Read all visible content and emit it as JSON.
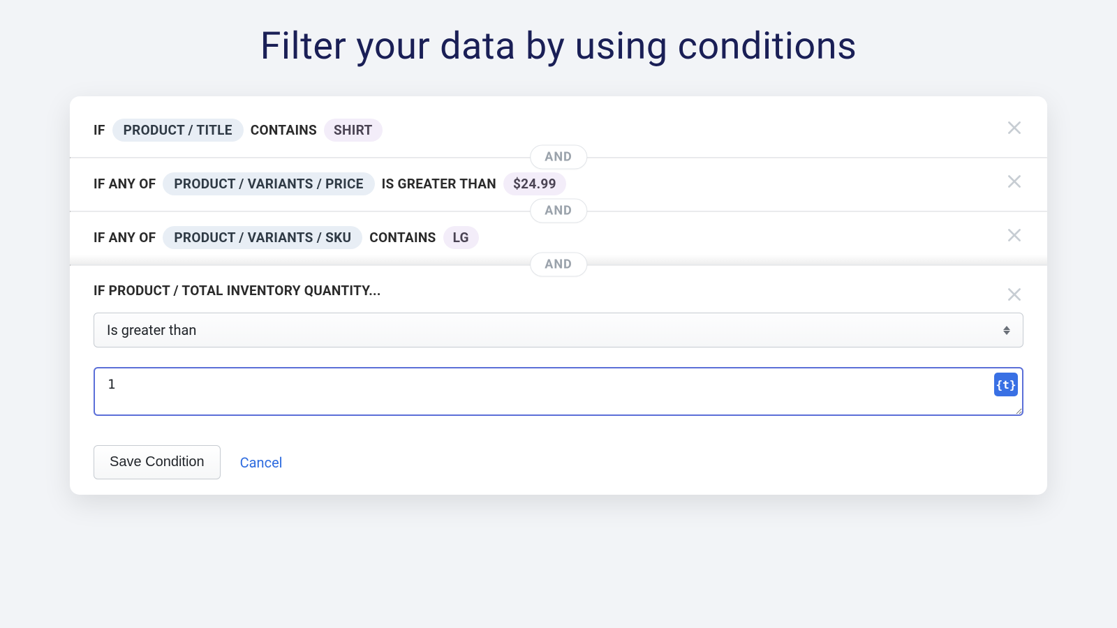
{
  "title": "Filter your data by using conditions",
  "connector": "AND",
  "conditions": [
    {
      "prefix": "IF",
      "field": "PRODUCT / TITLE",
      "op": "CONTAINS",
      "value": "SHIRT"
    },
    {
      "prefix": "IF ANY OF",
      "field": "PRODUCT / VARIANTS / PRICE",
      "op": "IS GREATER THAN",
      "value": "$24.99"
    },
    {
      "prefix": "IF ANY OF",
      "field": "PRODUCT / VARIANTS / SKU",
      "op": "CONTAINS",
      "value": "LG"
    }
  ],
  "edit": {
    "label": "IF PRODUCT / TOTAL INVENTORY QUANTITY...",
    "operator": "Is greater than",
    "value": "1",
    "template_button": "{t}"
  },
  "actions": {
    "save": "Save Condition",
    "cancel": "Cancel"
  }
}
